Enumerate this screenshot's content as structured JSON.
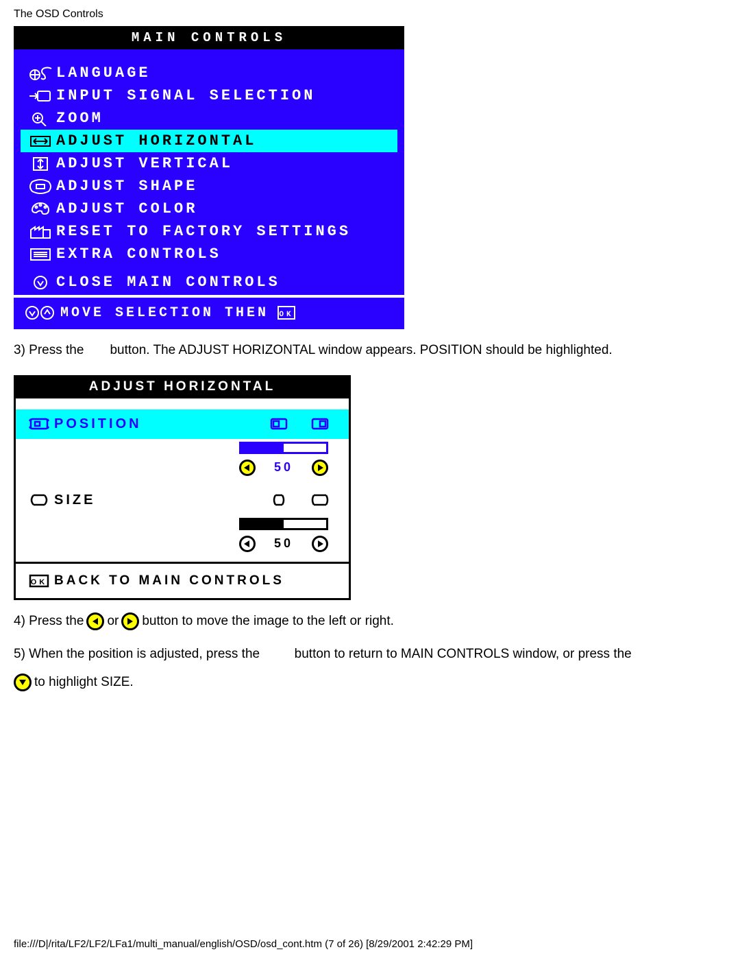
{
  "header": "The OSD Controls",
  "main_osd": {
    "title": "MAIN CONTROLS",
    "items": [
      "LANGUAGE",
      "INPUT SIGNAL SELECTION",
      "ZOOM",
      "ADJUST HORIZONTAL",
      "ADJUST VERTICAL",
      "ADJUST SHAPE",
      "ADJUST COLOR",
      "RESET TO FACTORY SETTINGS",
      "EXTRA CONTROLS",
      "CLOSE MAIN CONTROLS"
    ],
    "selected_index": 3,
    "footer_text": "MOVE SELECTION THEN",
    "footer_ok": "OK"
  },
  "step3": {
    "a": "3) Press the",
    "b": "button. The ADJUST HORIZONTAL window appears. POSITION should be highlighted."
  },
  "adj_osd": {
    "title": "ADJUST HORIZONTAL",
    "position_label": "POSITION",
    "position_value": "50",
    "size_label": "SIZE",
    "size_value": "50",
    "back_label": "BACK TO MAIN CONTROLS"
  },
  "step4": {
    "a": "4) Press the",
    "b": "or",
    "c": "button to move the image to the left or right."
  },
  "step5": {
    "a": "5) When the position is adjusted, press the",
    "b": "button to return to MAIN CONTROLS window, or press the",
    "c": "to highlight SIZE."
  },
  "footer_path": "file:///D|/rita/LF2/LF2/LFa1/multi_manual/english/OSD/osd_cont.htm (7 of 26) [8/29/2001 2:42:29 PM]"
}
